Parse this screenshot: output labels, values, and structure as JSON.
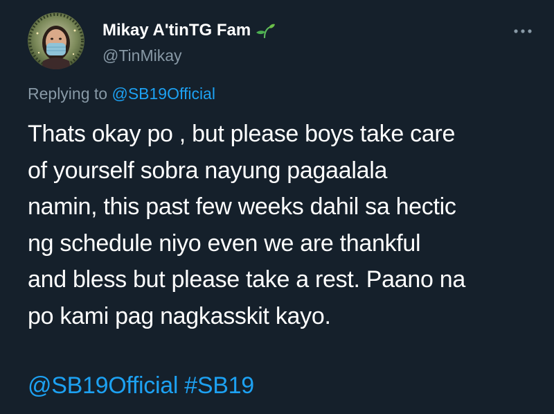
{
  "colors": {
    "background": "#15202b",
    "primary_text": "#ffffff",
    "secondary_text": "#8899a6",
    "link": "#1da1f2",
    "sprout_green": "#4caf50"
  },
  "author": {
    "display_name": "Mikay A'tinTG Fam",
    "handle": "@TinMikay",
    "name_emoji_icon": "sprout-icon",
    "avatar_icon": "avatar"
  },
  "more_menu_icon": "more-horizontal-icon",
  "reply": {
    "prefix": "Replying to",
    "mention": "@SB19Official"
  },
  "tweet": {
    "lines": [
      "Thats okay po , but please boys take care",
      "of yourself sobra nayung pagaalala",
      "namin, this past few weeks dahil sa hectic",
      "ng schedule niyo even we are thankful",
      "and bless but please take a rest. Paano na",
      "po kami pag nagkasskit kayo."
    ],
    "mention": "@SB19Official",
    "hashtag": "#SB19"
  }
}
